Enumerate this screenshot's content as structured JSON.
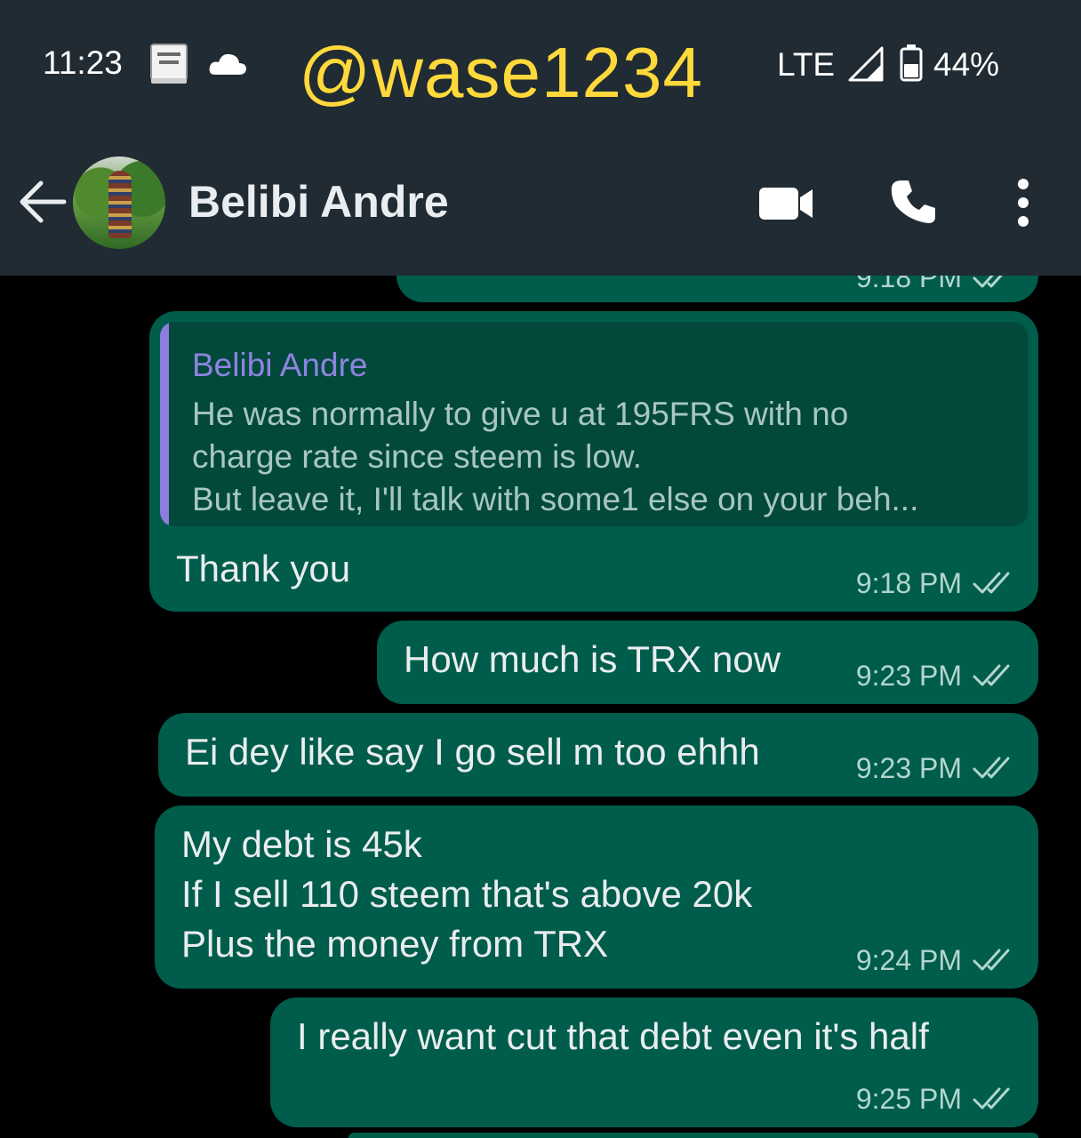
{
  "status_bar": {
    "time": "11:23",
    "network": "LTE",
    "battery": "44%",
    "icons": [
      "bible-icon",
      "cloud-icon",
      "signal-icon",
      "battery-icon"
    ]
  },
  "watermark": "@wase1234",
  "header": {
    "contact_name": "Belibi Andre",
    "icons": [
      "back-arrow-icon",
      "video-call-icon",
      "phone-icon",
      "more-options-icon"
    ]
  },
  "theme": {
    "header_bg": "#202b33",
    "chat_bg": "#000000",
    "bubble_outgoing": "#005c4b",
    "quote_accent": "#8b7ede",
    "watermark_color": "#ffd93b"
  },
  "messages": {
    "partial_top": {
      "time": "9:18 PM"
    },
    "m1": {
      "quote_author": "Belibi Andre",
      "quote_text": "He was normally to give u at 195FRS with no\ncharge rate since steem is low.\nBut leave it, I'll talk with some1 else on your beh...",
      "text": "Thank you",
      "time": "9:18 PM"
    },
    "m2": {
      "text": "How much is TRX now",
      "time": "9:23 PM"
    },
    "m3": {
      "text": "Ei dey like say I go sell m too ehhh",
      "time": "9:23 PM"
    },
    "m4": {
      "text": "My debt is 45k\nIf I sell 110 steem that's above 20k\nPlus the money from TRX",
      "time": "9:24 PM"
    },
    "m5": {
      "text": "I really want cut that debt even it's half",
      "time": "9:25 PM"
    }
  }
}
